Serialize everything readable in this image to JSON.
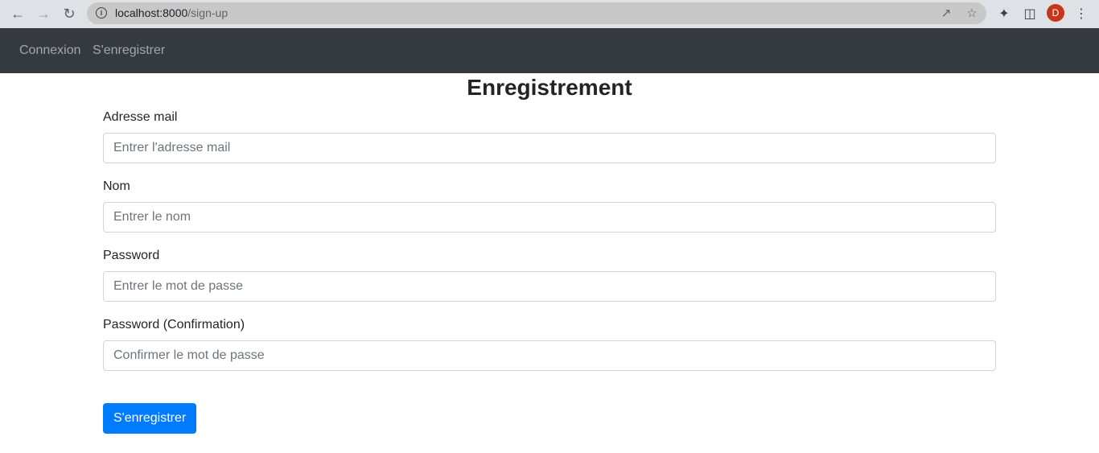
{
  "browser": {
    "url_host": "localhost:8000",
    "url_path": "/sign-up",
    "avatar_letter": "D",
    "icons": {
      "back": "arrow-left-icon",
      "forward": "arrow-right-icon",
      "reload": "reload-icon",
      "info": "info-icon",
      "share": "share-icon",
      "bookmark": "star-icon",
      "extensions": "puzzle-icon",
      "sidepanel": "side-panel-icon",
      "menu": "kebab-menu-icon"
    },
    "avatar_color": "#c5361b"
  },
  "navbar": {
    "background": "#343a40",
    "links": [
      "Connexion",
      "S'enregistrer"
    ]
  },
  "form": {
    "title": "Enregistrement",
    "fields": [
      {
        "label": "Adresse mail",
        "placeholder": "Entrer l'adresse mail",
        "value": ""
      },
      {
        "label": "Nom",
        "placeholder": "Entrer le nom",
        "value": ""
      },
      {
        "label": "Password",
        "placeholder": "Entrer le mot de passe",
        "value": ""
      },
      {
        "label": "Password (Confirmation)",
        "placeholder": "Confirmer le mot de passe",
        "value": ""
      }
    ],
    "submit_label": "S'enregistrer",
    "submit_color": "#007bff"
  }
}
